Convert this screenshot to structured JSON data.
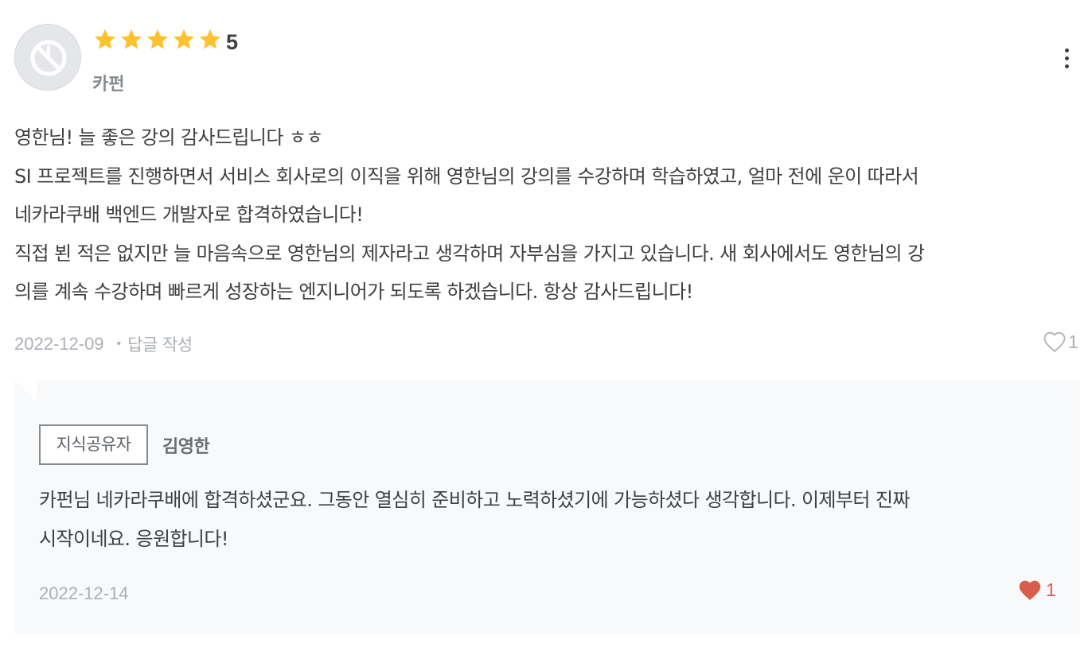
{
  "review": {
    "avatar_icon": "no-profile-icon",
    "rating": {
      "value": 5,
      "max": 5,
      "label": "5",
      "star_color": "#fdc22e"
    },
    "username": "카펀",
    "more_icon": "more-vertical-icon",
    "body_lines": [
      "영한님! 늘 좋은 강의 감사드립니다 ㅎㅎ",
      "SI 프로젝트를 진행하면서 서비스 회사로의 이직을 위해 영한님의 강의를 수강하며 학습하였고, 얼마 전에 운이 따라서",
      "네카라쿠배 백엔드 개발자로 합격하였습니다!",
      "직접 뵌 적은 없지만 늘 마음속으로 영한님의 제자라고 생각하며 자부심을 가지고 있습니다. 새 회사에서도 영한님의 강",
      "의를 계속 수강하며 빠르게 성장하는 엔지니어가 되도록 하겠습니다. 항상 감사드립니다!"
    ],
    "date": "2022-12-09",
    "separator": "•",
    "reply_link": "답글 작성",
    "like_icon": "heart-outline-icon",
    "like_count": "1"
  },
  "reply": {
    "badge": "지식공유자",
    "author": "김영한",
    "body_lines": [
      "카펀님 네카라쿠배에 합격하셨군요. 그동안 열심히 준비하고 노력하셨기에 가능하셨다 생각합니다. 이제부터 진짜",
      "시작이네요. 응원합니다!"
    ],
    "date": "2022-12-14",
    "like_icon": "heart-filled-icon",
    "like_count": "1",
    "like_color": "#d85d4b"
  }
}
